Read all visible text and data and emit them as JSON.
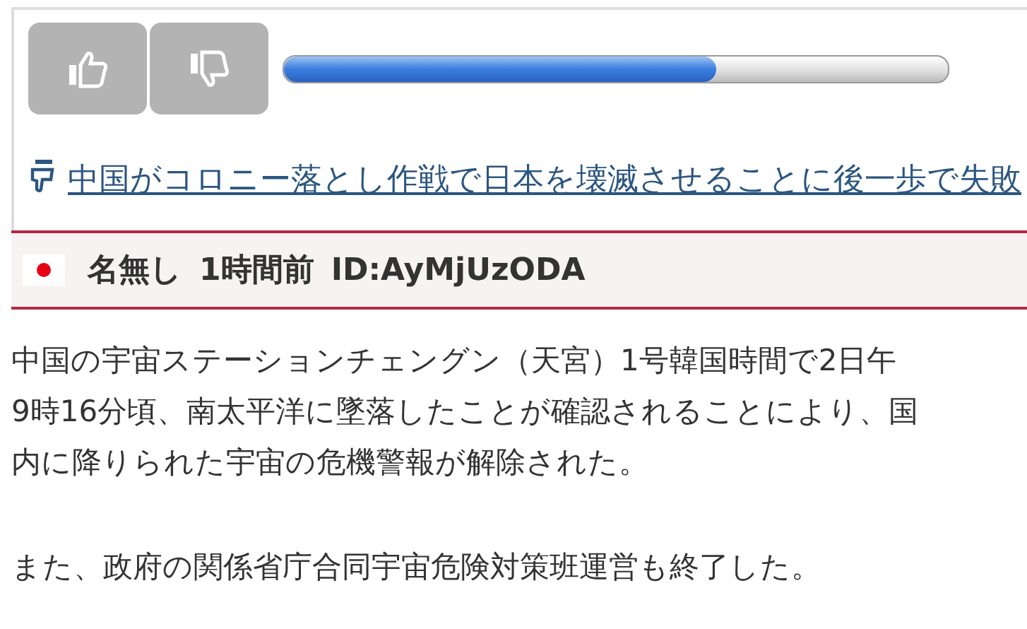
{
  "vote": {
    "level": 0.65
  },
  "related_link": {
    "text": "中国がコロニー落とし作戦で日本を壊滅させることに後一歩で失敗"
  },
  "post": {
    "name": "名無し",
    "time": "1時間前",
    "id": "ID:AyMjUzODA",
    "paragraphs": [
      {
        "lines": [
          "中国の宇宙ステーションチェングン（天宮）1号韓国時間で2日午",
          "9時16分頃、南太平洋に墜落したことが確認されることにより、国",
          "内に降りられた宇宙の危機警報が解除された。"
        ]
      },
      {
        "lines": [
          "また、政府の関係省庁合同宇宙危険対策班運営も終了した。"
        ]
      }
    ]
  }
}
